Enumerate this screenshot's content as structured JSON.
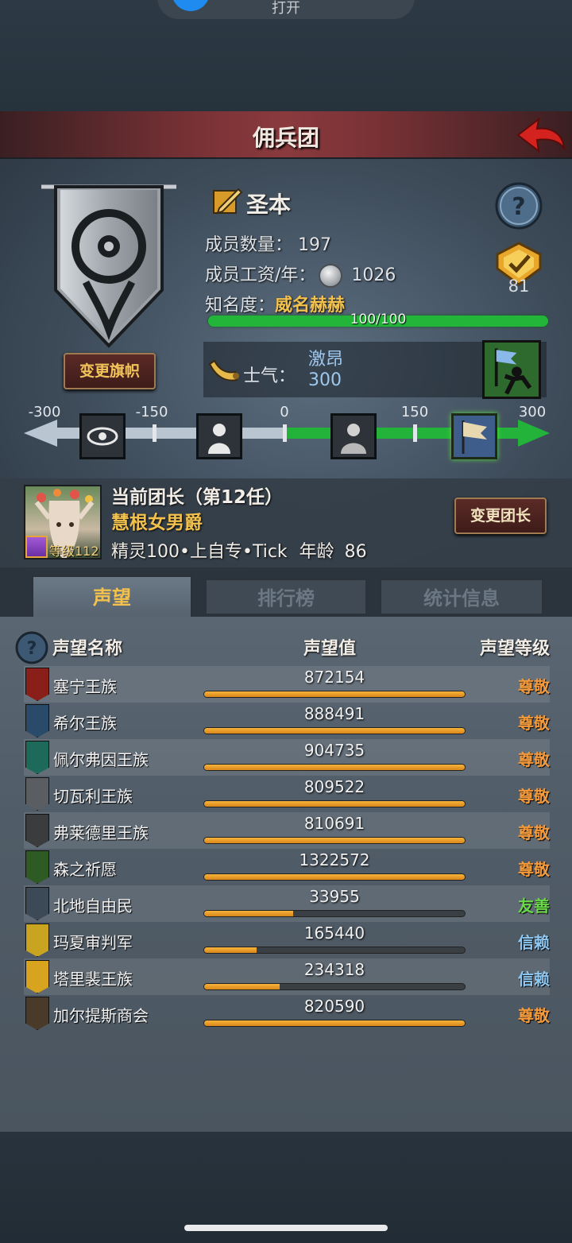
{
  "notification": {
    "text": "打开"
  },
  "header": {
    "title": "佣兵团"
  },
  "guild": {
    "name": "圣本",
    "members_label": "成员数量：",
    "members_value": "197",
    "wage_label": "成员工资/年：",
    "wage_value": "1026",
    "fame_label": "知名度：",
    "fame_name": "威名赫赫",
    "fame_progress_text": "100/100",
    "fame_progress": 1.0,
    "rank": "81",
    "change_flag_label": "变更旗帜"
  },
  "morale": {
    "label": "士气：",
    "name": "激昂",
    "value": "300",
    "scale_ticks": [
      "-300",
      "-150",
      "0",
      "150",
      "300"
    ],
    "scale_icons": [
      "eye-icon",
      "despair-icon",
      "calm-icon",
      "banner-charge-icon"
    ],
    "active_index": 3
  },
  "leader": {
    "title": "当前团长（第12任）",
    "name": "慧根女男爵",
    "level": "等级112",
    "info": "精灵100•上自专•Tick",
    "age_label": "年龄",
    "age": "86",
    "change_leader_label": "变更团长"
  },
  "tabs": [
    {
      "label": "声望",
      "active": true
    },
    {
      "label": "排行榜",
      "active": false
    },
    {
      "label": "统计信息",
      "active": false
    }
  ],
  "table": {
    "headers": {
      "name": "声望名称",
      "value": "声望值",
      "level": "声望等级"
    },
    "rows": [
      {
        "name": "塞宁王族",
        "value": "872154",
        "level": "尊敬",
        "fill": 1.0,
        "emblem_color": "#8a1f1a"
      },
      {
        "name": "希尔王族",
        "value": "888491",
        "level": "尊敬",
        "fill": 1.0,
        "emblem_color": "#2a4a6a"
      },
      {
        "name": "佩尔弗因王族",
        "value": "904735",
        "level": "尊敬",
        "fill": 1.0,
        "emblem_color": "#1e6a5a"
      },
      {
        "name": "切瓦利王族",
        "value": "809522",
        "level": "尊敬",
        "fill": 1.0,
        "emblem_color": "#5a5e62"
      },
      {
        "name": "弗莱德里王族",
        "value": "810691",
        "level": "尊敬",
        "fill": 1.0,
        "emblem_color": "#3a3c3e"
      },
      {
        "name": "森之祈愿",
        "value": "1322572",
        "level": "尊敬",
        "fill": 1.0,
        "emblem_color": "#2e5a24"
      },
      {
        "name": "北地自由民",
        "value": "33955",
        "level": "友善",
        "fill": 0.34,
        "emblem_color": "#3c4a58"
      },
      {
        "name": "玛夏审判军",
        "value": "165440",
        "level": "信赖",
        "fill": 0.2,
        "emblem_color": "#c8a420"
      },
      {
        "name": "塔里裴王族",
        "value": "234318",
        "level": "信赖",
        "fill": 0.29,
        "emblem_color": "#d8a420"
      },
      {
        "name": "加尔提斯商会",
        "value": "820590",
        "level": "尊敬",
        "fill": 1.0,
        "emblem_color": "#4a3a2a"
      }
    ],
    "level_colors": {
      "尊敬": "#f39a3c",
      "友善": "#6bd84a",
      "信赖": "#8ec8f2"
    }
  }
}
